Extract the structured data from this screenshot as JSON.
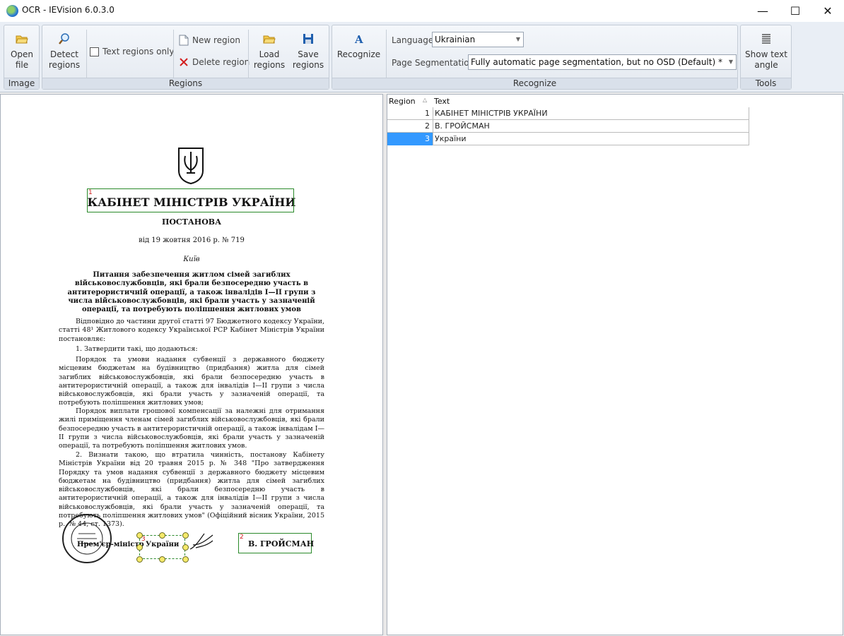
{
  "window": {
    "title": "OCR - IEVision 6.0.3.0",
    "minimize": "—",
    "maximize": "☐",
    "close": "✕"
  },
  "ribbon": {
    "image": {
      "label": "Image",
      "open_file_line1": "Open",
      "open_file_line2": "file"
    },
    "regions": {
      "label": "Regions",
      "detect_line1": "Detect",
      "detect_line2": "regions",
      "text_regions_only": "Text regions only",
      "new_region": "New region",
      "delete_region": "Delete region",
      "load_line1": "Load",
      "load_line2": "regions",
      "save_line1": "Save",
      "save_line2": "regions"
    },
    "recognize": {
      "label": "Recognize",
      "button": "Recognize",
      "language_label": "Language",
      "language_value": "Ukrainian",
      "seg_label": "Page Segmentation",
      "seg_value": "Fully automatic page segmentation, but no OSD (Default) *"
    },
    "tools": {
      "label": "Tools",
      "angle_line1": "Show text",
      "angle_line2": "angle"
    }
  },
  "grid": {
    "col_region": "Region",
    "col_text": "Text",
    "rows": [
      {
        "region": "1",
        "text": "КАБІНЕТ МІНІСТРІВ УКРАЇНИ"
      },
      {
        "region": "2",
        "text": "В. ГРОЙСМАН"
      },
      {
        "region": "3",
        "text": "України"
      }
    ]
  },
  "document": {
    "heading": "КАБІНЕТ МІНІСТРІВ УКРАЇНИ",
    "resolution": "ПОСТАНОВА",
    "date": "від 19 жовтня 2016 р. № 719",
    "city": "Київ",
    "subject": "Питання забезпечення житлом сімей загиблих військовослужбовців, які брали безпосередню участь в антитерористичній операції, а також інвалідів I—II групи з числа військовослужбовців, які брали участь у зазначеній операції, та потребують поліпшення житлових умов",
    "p1": "Відповідно до частини другої статті 97 Бюджетного кодексу України, статті 48¹ Житлового кодексу Української РСР Кабінет Міністрів України постановляє:",
    "p2": "1. Затвердити такі, що додаються:",
    "p3": "Порядок та умови надання субвенції з державного бюджету місцевим бюджетам на будівництво (придбання) житла для сімей загиблих військовослужбовців, які брали безпосередню участь в антитерористичній операції, а також для інвалідів I—II групи з числа військовослужбовців, які брали участь у зазначеній операції, та потребують поліпшення житлових умов;",
    "p4": "Порядок виплати грошової компенсації за належні для отримання жилі приміщення членам сімей загиблих військовослужбовців, які брали безпосередню участь в антитерористичній операції, а також інвалідам I—II групи з числа військовослужбовців, які брали участь у зазначеній операції, та потребують поліпшення житлових умов.",
    "p5": "2. Визнати такою, що втратила чинність, постанову Кабінету Міністрів України від 20 травня 2015 р. № 348 \"Про затвердження Порядку та умов надання субвенції з державного бюджету місцевим бюджетам на будівництво (придбання) житла для сімей загиблих військовослужбовців, які брали безпосередню участь в антитерористичній операції, а також для інвалідів I—II групи з числа військовослужбовців, які брали участь у зазначеній операції, та потребують поліпшення житлових умов\" (Офіційний вісник України, 2015 р., № 44, ст. 1373).",
    "pm_label_a": "Прем'єр-міністр",
    "pm_label_b": "України",
    "signer": "В. ГРОЙСМАН",
    "region_numbers": [
      "1",
      "2",
      "3"
    ]
  }
}
